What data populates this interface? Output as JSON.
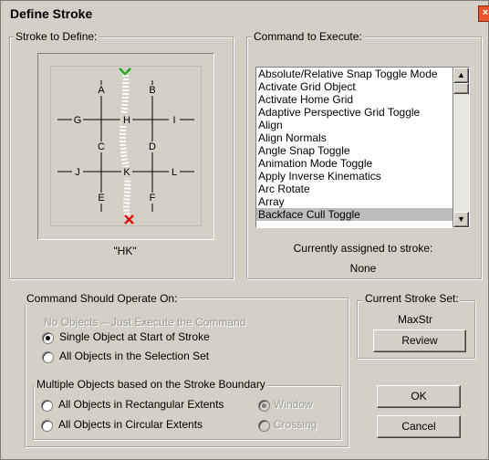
{
  "window": {
    "title": "Define Stroke",
    "close_glyph": "×"
  },
  "stroke_group": {
    "label": "Stroke to Define:",
    "grid_letters": [
      "A",
      "B",
      "G",
      "H",
      "I",
      "C",
      "D",
      "J",
      "K",
      "L",
      "E",
      "F"
    ],
    "stroke_name": "\"HK\""
  },
  "command_group": {
    "label": "Command to Execute:",
    "items": [
      "Absolute/Relative Snap Toggle Mode",
      "Activate Grid Object",
      "Activate Home Grid",
      "Adaptive Perspective Grid Toggle",
      "Align",
      "Align Normals",
      "Angle Snap Toggle",
      "Animation Mode Toggle",
      "Apply Inverse Kinematics",
      "Arc Rotate",
      "Array",
      "Backface Cull Toggle"
    ],
    "selected_index": 11,
    "assigned_label": "Currently assigned to stroke:",
    "assigned_value": "None"
  },
  "operate_group": {
    "label": "Command Should Operate On:",
    "no_objects": "No Objects -- Just Execute the Command",
    "single_object": "Single Object at Start of Stroke",
    "all_selection": "All Objects in the Selection Set",
    "selected": "single_object"
  },
  "multiple_group": {
    "label": "Multiple Objects based on the Stroke Boundary",
    "rect": "All Objects in Rectangular Extents",
    "circ": "All Objects in Circular Extents",
    "window": "Window",
    "crossing": "Crossing",
    "window_selected": true
  },
  "stroke_set_group": {
    "label": "Current Stroke Set:",
    "name": "MaxStr",
    "review": "Review"
  },
  "buttons": {
    "ok": "OK",
    "cancel": "Cancel"
  },
  "colors": {
    "stroke_start": "#22aa22",
    "stroke_end": "#dd1111",
    "dialog_bg": "#d4d0c8"
  }
}
